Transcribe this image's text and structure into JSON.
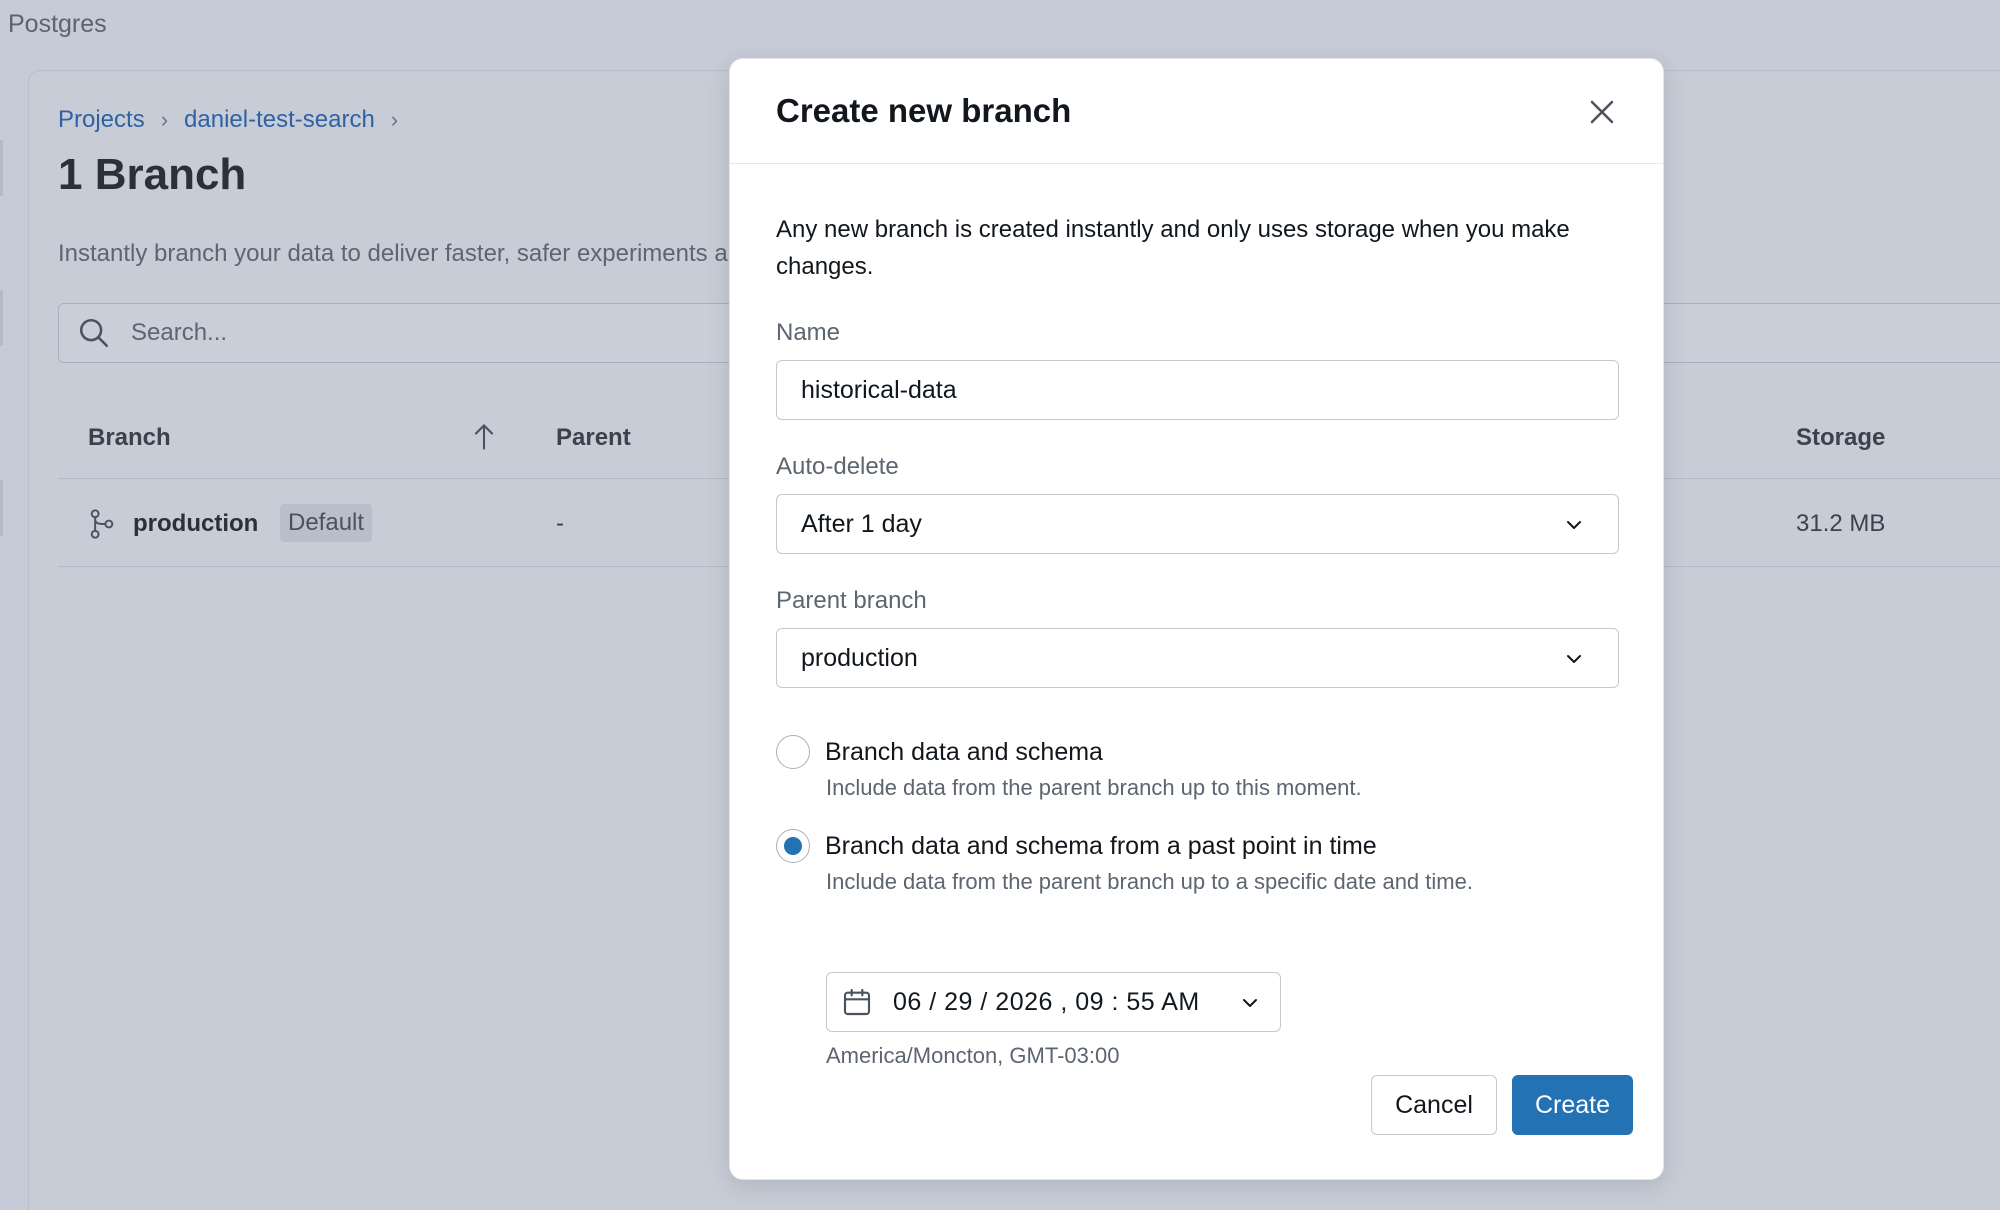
{
  "app": {
    "title": "Postgres"
  },
  "breadcrumb": {
    "projects": "Projects",
    "project": "daniel-test-search",
    "sep": "›"
  },
  "page": {
    "title": "1 Branch",
    "description": "Instantly branch your data to deliver faster, safer experiments and workflows"
  },
  "search": {
    "placeholder": "Search..."
  },
  "table": {
    "headers": {
      "branch": "Branch",
      "parent": "Parent",
      "storage": "Storage"
    },
    "rows": [
      {
        "branch": "production",
        "badge": "Default",
        "parent": "-",
        "storage": "31.2 MB"
      }
    ]
  },
  "modal": {
    "title": "Create new branch",
    "intro": "Any new branch is created instantly and only uses storage when you make changes.",
    "name_label": "Name",
    "name_value": "historical-data",
    "autodelete_label": "Auto-delete",
    "autodelete_value": "After 1 day",
    "parent_label": "Parent branch",
    "parent_value": "production",
    "options": [
      {
        "label": "Branch data and schema",
        "help": "Include data from the parent branch up to this moment.",
        "checked": false
      },
      {
        "label": "Branch data and schema from a past point in time",
        "help": "Include data from the parent branch up to a specific date and time.",
        "checked": true
      }
    ],
    "datetime_value": "06 / 29 / 2026 ,  09 : 55   AM",
    "timezone": "America/Moncton, GMT-03:00",
    "cancel_label": "Cancel",
    "create_label": "Create"
  },
  "colors": {
    "primary": "#2272b4",
    "link": "#2f62a3",
    "overlay": "#c6cbd7"
  }
}
